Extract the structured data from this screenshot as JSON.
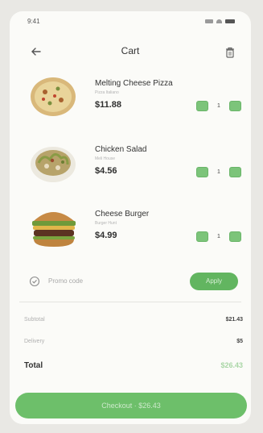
{
  "status": {
    "time": "9:41"
  },
  "header": {
    "title": "Cart"
  },
  "items": [
    {
      "name": "Melting Cheese Pizza",
      "subtitle": "Pizza Italiano",
      "price": "$11.88",
      "quantity": "1"
    },
    {
      "name": "Chicken Salad",
      "subtitle": "Meli House",
      "price": "$4.56",
      "quantity": "1"
    },
    {
      "name": "Cheese Burger",
      "subtitle": "Burger Hunt",
      "price": "$4.99",
      "quantity": "1"
    }
  ],
  "promo": {
    "label": "Promo code",
    "apply_label": "Apply"
  },
  "summary": {
    "subtotal_label": "Subtotal",
    "subtotal_value": "$21.43",
    "delivery_label": "Delivery",
    "delivery_value": "$5",
    "total_label": "Total",
    "total_value": "$26.43"
  },
  "checkout": {
    "label": "Checkout · $26.43"
  },
  "colors": {
    "accent": "#62b560",
    "stepper": "#7cc47a",
    "background": "#fbfbf8"
  }
}
